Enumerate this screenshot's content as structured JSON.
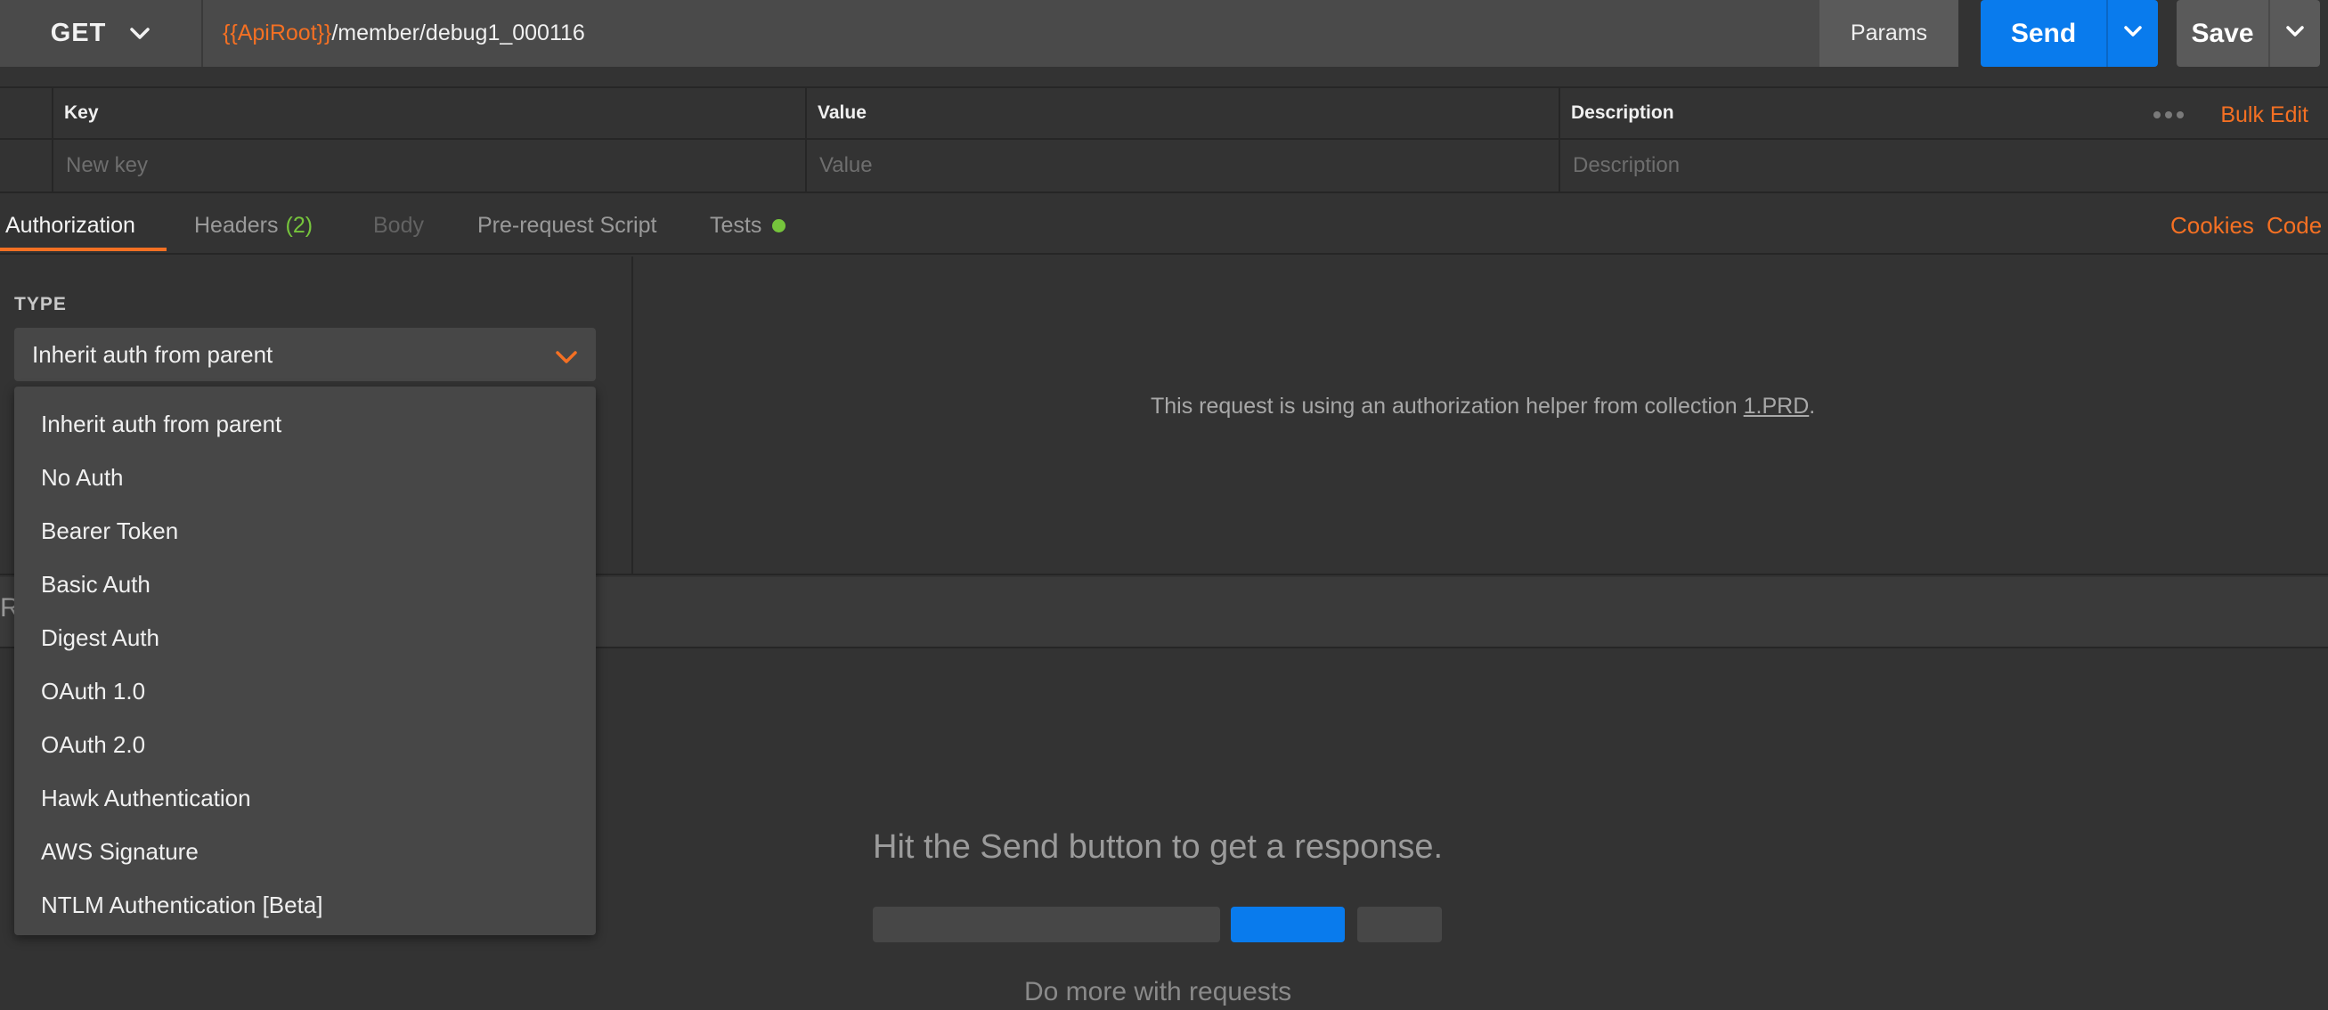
{
  "request": {
    "method": "GET",
    "url_variable": "{{ApiRoot}}",
    "url_path": "/member/debug1_000116",
    "params_label": "Params",
    "send_label": "Send",
    "save_label": "Save"
  },
  "params_table": {
    "headers": {
      "key": "Key",
      "value": "Value",
      "description": "Description"
    },
    "placeholders": {
      "key": "New key",
      "value": "Value",
      "description": "Description"
    },
    "bulk_edit_label": "Bulk Edit"
  },
  "tabs": [
    {
      "label": "Authorization",
      "state": "active"
    },
    {
      "label": "Headers",
      "count": "(2)"
    },
    {
      "label": "Body",
      "state": "disabled"
    },
    {
      "label": "Pre-request Script"
    },
    {
      "label": "Tests",
      "indicator": "green-dot"
    }
  ],
  "tab_links": {
    "cookies": "Cookies",
    "code": "Code"
  },
  "auth": {
    "type_label": "TYPE",
    "selected": "Inherit auth from parent",
    "message_prefix": "This request is using an authorization helper from collection ",
    "collection_link": "1.PRD",
    "message_suffix": ".",
    "options": [
      "Inherit auth from parent",
      "No Auth",
      "Bearer Token",
      "Basic Auth",
      "Digest Auth",
      "OAuth 1.0",
      "OAuth 2.0",
      "Hawk Authentication",
      "AWS Signature",
      "NTLM Authentication [Beta]"
    ]
  },
  "response": {
    "truncated_label": "R",
    "empty_message": "Hit the Send button to get a response.",
    "do_more": "Do more with requests"
  },
  "colors": {
    "accent": "#f47023",
    "primary_button": "#097bed",
    "success": "#76c43c",
    "background": "#333333"
  }
}
